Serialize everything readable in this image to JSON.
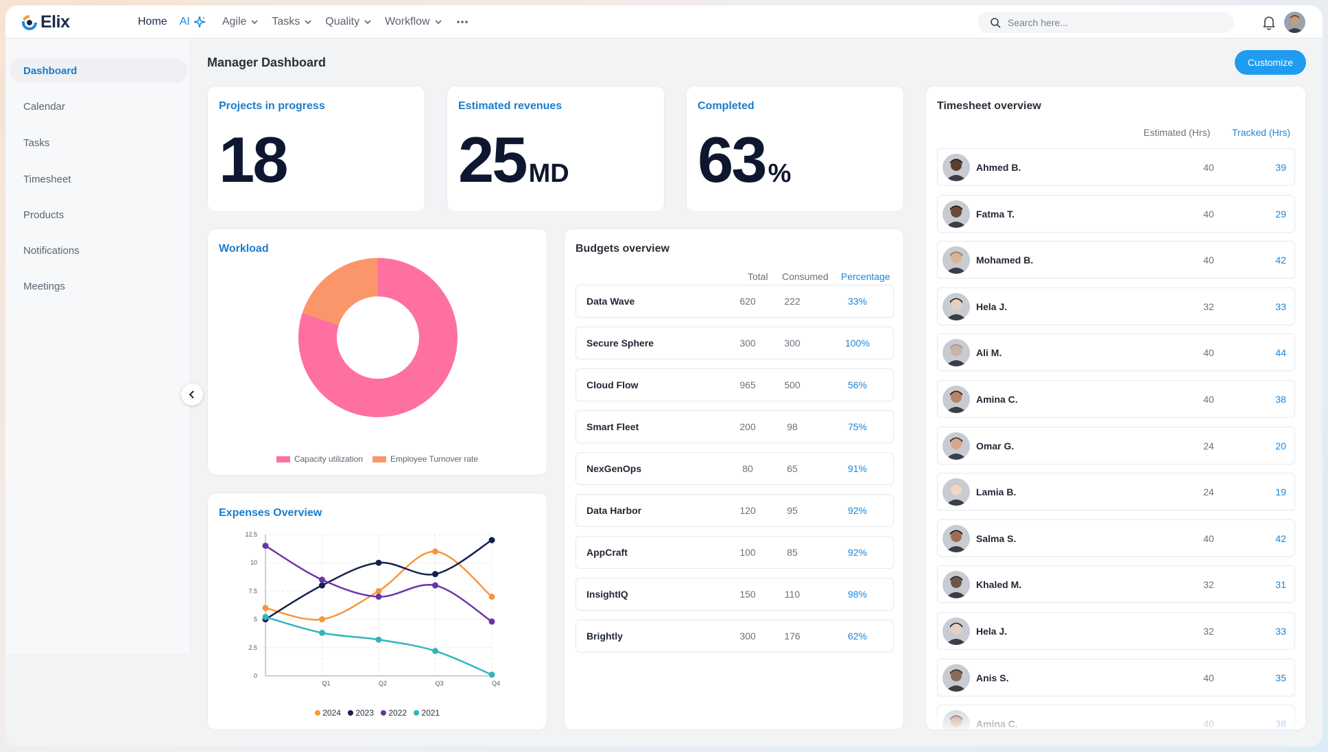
{
  "app": {
    "name": "Elix"
  },
  "nav": {
    "home": "Home",
    "ai": "AI",
    "agile": "Agile",
    "tasks": "Tasks",
    "quality": "Quality",
    "workflow": "Workflow"
  },
  "search": {
    "placeholder": "Search here..."
  },
  "sidebar": {
    "items": [
      {
        "label": "Dashboard",
        "active": true
      },
      {
        "label": "Calendar"
      },
      {
        "label": "Tasks"
      },
      {
        "label": "Timesheet"
      },
      {
        "label": "Products"
      },
      {
        "label": "Notifications"
      },
      {
        "label": "Meetings"
      }
    ]
  },
  "page": {
    "title": "Manager Dashboard",
    "customize_label": "Customize"
  },
  "stats": {
    "projects": {
      "title": "Projects in progress",
      "value": "18",
      "unit": ""
    },
    "revenues": {
      "title": "Estimated revenues",
      "value": "25",
      "unit": "MD"
    },
    "completed": {
      "title": "Completed",
      "value": "63",
      "unit": "%"
    }
  },
  "workload": {
    "title": "Workload",
    "legend": [
      "Capacity utilization",
      "Employee Turnover rate"
    ],
    "colors": [
      "#fe6fa2",
      "#fb966a"
    ],
    "chart_data": {
      "type": "pie",
      "labels": [
        "Capacity utilization",
        "Employee Turnover rate"
      ],
      "values": [
        80,
        20
      ]
    }
  },
  "budgets": {
    "title": "Budgets overview",
    "headers": [
      "Total",
      "Consumed",
      "Percentage"
    ],
    "rows": [
      {
        "name": "Data Wave",
        "total": "620",
        "consumed": "222",
        "pct": "33%"
      },
      {
        "name": "Secure Sphere",
        "total": "300",
        "consumed": "300",
        "pct": "100%"
      },
      {
        "name": "Cloud Flow",
        "total": "965",
        "consumed": "500",
        "pct": "56%"
      },
      {
        "name": "Smart Fleet",
        "total": "200",
        "consumed": "98",
        "pct": "75%"
      },
      {
        "name": "NexGenOps",
        "total": "80",
        "consumed": "65",
        "pct": "91%"
      },
      {
        "name": "Data Harbor",
        "total": "120",
        "consumed": "95",
        "pct": "92%"
      },
      {
        "name": "AppCraft",
        "total": "100",
        "consumed": "85",
        "pct": "92%"
      },
      {
        "name": "InsightIQ",
        "total": "150",
        "consumed": "110",
        "pct": "98%"
      },
      {
        "name": "Brightly",
        "total": "300",
        "consumed": "176",
        "pct": "62%"
      }
    ]
  },
  "timesheet": {
    "title": "Timesheet overview",
    "headers": [
      "Estimated (Hrs)",
      "Tracked (Hrs)"
    ],
    "rows": [
      {
        "name": "Ahmed B.",
        "est": "40",
        "trk": "39",
        "skin": "#5a3d2b",
        "hair": "#1d1512"
      },
      {
        "name": "Fatma T.",
        "est": "40",
        "trk": "29",
        "skin": "#6b4a36",
        "hair": "#171210"
      },
      {
        "name": "Mohamed B.",
        "est": "40",
        "trk": "42",
        "skin": "#d9b494",
        "hair": "#8d7560"
      },
      {
        "name": "Hela J.",
        "est": "32",
        "trk": "33",
        "skin": "#e6cfc0",
        "hair": "#2a2220"
      },
      {
        "name": "Ali M.",
        "est": "40",
        "trk": "44",
        "skin": "#c9b3a4",
        "hair": "#9a9494"
      },
      {
        "name": "Amina C.",
        "est": "40",
        "trk": "38",
        "skin": "#b88464",
        "hair": "#2a1c16"
      },
      {
        "name": "Omar G.",
        "est": "24",
        "trk": "20",
        "skin": "#d8a888",
        "hair": "#3b2a20"
      },
      {
        "name": "Lamia B.",
        "est": "24",
        "trk": "19",
        "skin": "#eed6c8",
        "hair": "#d8c3a4"
      },
      {
        "name": "Salma S.",
        "est": "40",
        "trk": "42",
        "skin": "#9e6e52",
        "hair": "#1b1512"
      },
      {
        "name": "Khaled M.",
        "est": "32",
        "trk": "31",
        "skin": "#6e5548",
        "hair": "#26201e"
      },
      {
        "name": "Hela J.",
        "est": "32",
        "trk": "33",
        "skin": "#e6cfc0",
        "hair": "#2a2220"
      },
      {
        "name": "Anis S.",
        "est": "40",
        "trk": "35",
        "skin": "#8a6a58",
        "hair": "#2d2420"
      },
      {
        "name": "Amina C.",
        "est": "40",
        "trk": "38",
        "skin": "#b88464",
        "hair": "#2a1c16"
      }
    ]
  },
  "expenses": {
    "title": "Expenses Overview",
    "chart_data": {
      "type": "line",
      "x": [
        "",
        "Q1",
        "Q2",
        "Q3",
        "Q4"
      ],
      "ylim": [
        0,
        12.5
      ],
      "yticks": [
        "0",
        "2.5",
        "5",
        "7.5",
        "10",
        "12.5"
      ],
      "grid": true,
      "legend_position": "bottom",
      "series": [
        {
          "name": "2024",
          "color": "#f7953a",
          "values": [
            6.0,
            5.0,
            7.5,
            11.0,
            7.0
          ]
        },
        {
          "name": "2023",
          "color": "#15204d",
          "values": [
            5.0,
            8.0,
            10.0,
            9.0,
            12.0
          ]
        },
        {
          "name": "2022",
          "color": "#6a34a8",
          "values": [
            11.5,
            8.5,
            7.0,
            8.0,
            4.8
          ]
        },
        {
          "name": "2021",
          "color": "#33b4bd",
          "values": [
            5.2,
            3.8,
            3.2,
            2.2,
            0.1
          ]
        }
      ]
    }
  }
}
